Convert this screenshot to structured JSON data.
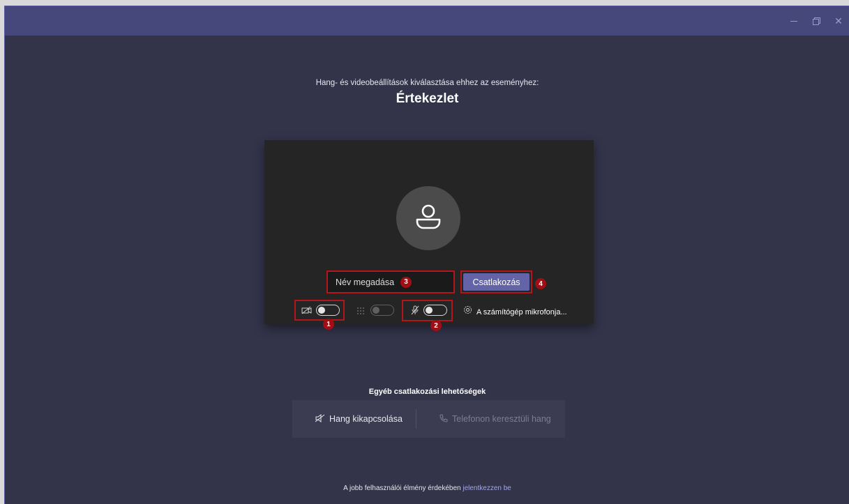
{
  "heading": {
    "subtitle": "Hang- és videobeállítások kiválasztása ehhez az eseményhez:",
    "title": "Értekezlet"
  },
  "preview": {
    "name_placeholder": "Név megadása",
    "join_label": "Csatlakozás",
    "mic_device_label": "A számítógép mikrofonja...",
    "video_toggle_on": false,
    "blur_toggle_on": false,
    "mic_toggle_on": false
  },
  "annotations": {
    "video_toggle": "1",
    "mic_toggle": "2",
    "name_field": "3",
    "join_button": "4",
    "color": "#a10e14"
  },
  "other_options": {
    "title": "Egyéb csatlakozási lehetőségek",
    "audio_off_label": "Hang kikapcsolása",
    "phone_audio_label": "Telefonon keresztüli hang"
  },
  "footer": {
    "text": "A jobb felhasználói élmény érdekében",
    "link": "jelentkezzen be"
  },
  "icons": {
    "video_off": "video-off-icon",
    "blur": "background-blur-icon",
    "mic_off": "mic-off-icon",
    "settings": "gear-icon",
    "speaker_off": "speaker-off-icon",
    "phone": "phone-icon",
    "avatar": "person-icon"
  },
  "colors": {
    "accent": "#6264a7",
    "background": "#33344a",
    "titlebar": "#46477a",
    "preview": "#252525"
  }
}
